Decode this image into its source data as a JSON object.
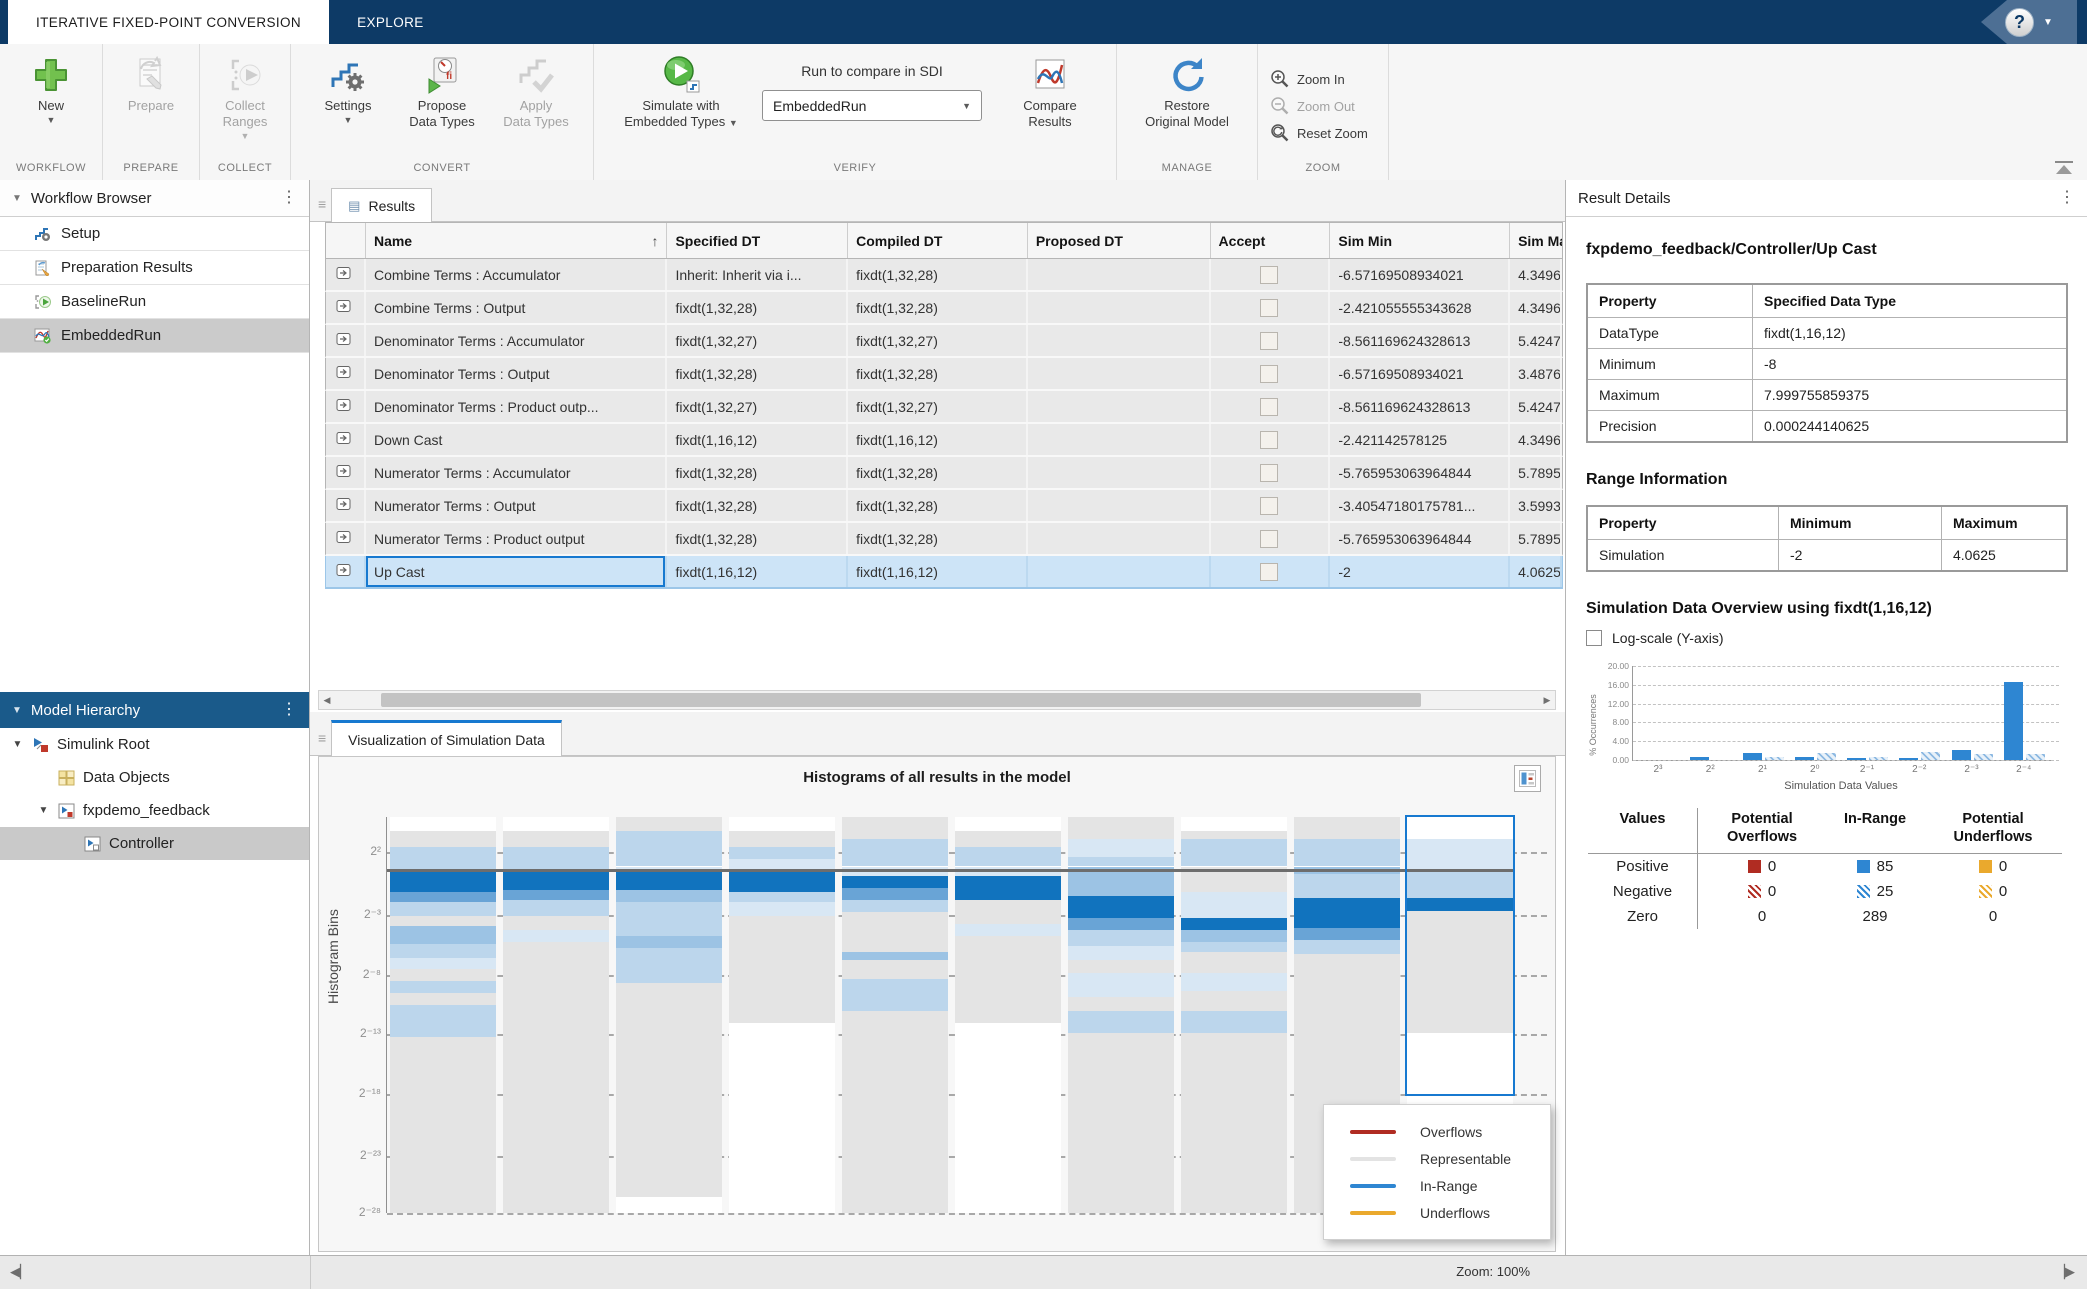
{
  "colors": {
    "tabbar": "#0d3a66",
    "accent_blue": "#1779d0",
    "selection_blue": "#cde4f7",
    "overflow_red": "#b02c22",
    "representable_gray": "#e3e3e3",
    "inrange_blue": "#2e86d2",
    "underflow_yellow": "#eaa92d",
    "hist": {
      "rep": "#e4e4e4",
      "b1": "#d8e7f4",
      "b2": "#bcd6ec",
      "b3": "#9cc3e4",
      "b4": "#69a4d6",
      "b5": "#1173be"
    }
  },
  "icons": {
    "help-icon": "? in circle",
    "new-icon": "green plus",
    "prepare-icon": "document with pencil",
    "collect-icon": "brackets with play",
    "settings-icon": "steps with gear",
    "propose-icon": "gauge fi with play",
    "apply-icon": "steps with check",
    "simulate-icon": "green play circle",
    "compare-icon": "red blue curves",
    "restore-icon": "blue undo arrow",
    "zoom-in-icon": "magnifier plus",
    "zoom-out-icon": "magnifier minus",
    "reset-zoom-icon": "magnifier reset",
    "kebab-icon": "vertical dots",
    "signal-icon": "boxed arrow",
    "sort-ascending-icon": "up arrow",
    "checkbox": "empty square"
  },
  "tabs": {
    "iterative": "ITERATIVE FIXED-POINT CONVERSION",
    "explore": "EXPLORE"
  },
  "ribbon": {
    "sections": [
      "WORKFLOW",
      "PREPARE",
      "COLLECT",
      "CONVERT",
      "VERIFY",
      "MANAGE",
      "ZOOM"
    ],
    "new_label": "New",
    "prepare_label": "Prepare",
    "collect_label": "Collect\nRanges",
    "settings_label": "Settings",
    "propose_label": "Propose\nData Types",
    "apply_label": "Apply\nData Types",
    "simulate_label": "Simulate with\nEmbedded Types",
    "run_compare_label": "Run to compare in SDI",
    "run_dropdown_value": "EmbeddedRun",
    "compare_label": "Compare\nResults",
    "restore_label": "Restore\nOriginal Model",
    "zoom_in_label": "Zoom In",
    "zoom_out_label": "Zoom Out",
    "reset_zoom_label": "Reset Zoom"
  },
  "workflow_browser": {
    "title": "Workflow Browser",
    "items": [
      {
        "label": "Setup",
        "icon": "setup",
        "selected": false
      },
      {
        "label": "Preparation Results",
        "icon": "prep",
        "selected": false
      },
      {
        "label": "BaselineRun",
        "icon": "baseline",
        "selected": false
      },
      {
        "label": "EmbeddedRun",
        "icon": "embedded",
        "selected": true
      }
    ]
  },
  "model_hierarchy": {
    "title": "Model Hierarchy",
    "items": [
      {
        "label": "Simulink Root",
        "depth": 0,
        "expanded": true,
        "icon": "simulink",
        "selected": false
      },
      {
        "label": "Data Objects",
        "depth": 1,
        "expanded": null,
        "icon": "data",
        "selected": false
      },
      {
        "label": "fxpdemo_feedback",
        "depth": 1,
        "expanded": true,
        "icon": "model",
        "selected": false
      },
      {
        "label": "Controller",
        "depth": 2,
        "expanded": null,
        "icon": "subsystem",
        "selected": true
      }
    ]
  },
  "results_panel": {
    "tab": "Results",
    "columns": [
      "",
      "Name",
      "Specified DT",
      "Compiled DT",
      "Proposed DT",
      "Accept",
      "Sim Min",
      "Sim Max"
    ],
    "rows": [
      {
        "name": "Combine Terms : Accumulator",
        "specified": "Inherit: Inherit via i...",
        "compiled": "fixdt(1,32,28)",
        "proposed": "",
        "accept": false,
        "sim_min": "-6.57169508934021",
        "sim_max": "4.3496",
        "selected": false
      },
      {
        "name": "Combine Terms : Output",
        "specified": "fixdt(1,32,28)",
        "compiled": "fixdt(1,32,28)",
        "proposed": "",
        "accept": false,
        "sim_min": "-2.421055555343628",
        "sim_max": "4.3496",
        "selected": false
      },
      {
        "name": "Denominator Terms : Accumulator",
        "specified": "fixdt(1,32,27)",
        "compiled": "fixdt(1,32,27)",
        "proposed": "",
        "accept": false,
        "sim_min": "-8.561169624328613",
        "sim_max": "5.4247",
        "selected": false
      },
      {
        "name": "Denominator Terms : Output",
        "specified": "fixdt(1,32,28)",
        "compiled": "fixdt(1,32,28)",
        "proposed": "",
        "accept": false,
        "sim_min": "-6.57169508934021",
        "sim_max": "3.4876",
        "selected": false
      },
      {
        "name": "Denominator Terms : Product outp...",
        "specified": "fixdt(1,32,27)",
        "compiled": "fixdt(1,32,27)",
        "proposed": "",
        "accept": false,
        "sim_min": "-8.561169624328613",
        "sim_max": "5.4247",
        "selected": false
      },
      {
        "name": "Down Cast",
        "specified": "fixdt(1,16,12)",
        "compiled": "fixdt(1,16,12)",
        "proposed": "",
        "accept": false,
        "sim_min": "-2.421142578125",
        "sim_max": "4.3496",
        "selected": false
      },
      {
        "name": "Numerator Terms : Accumulator",
        "specified": "fixdt(1,32,28)",
        "compiled": "fixdt(1,32,28)",
        "proposed": "",
        "accept": false,
        "sim_min": "-5.765953063964844",
        "sim_max": "5.7895",
        "selected": false
      },
      {
        "name": "Numerator Terms : Output",
        "specified": "fixdt(1,32,28)",
        "compiled": "fixdt(1,32,28)",
        "proposed": "",
        "accept": false,
        "sim_min": "-3.40547180175781...",
        "sim_max": "3.5993",
        "selected": false
      },
      {
        "name": "Numerator Terms : Product output",
        "specified": "fixdt(1,32,28)",
        "compiled": "fixdt(1,32,28)",
        "proposed": "",
        "accept": false,
        "sim_min": "-5.765953063964844",
        "sim_max": "5.7895",
        "selected": false
      },
      {
        "name": "Up Cast",
        "specified": "fixdt(1,16,12)",
        "compiled": "fixdt(1,16,12)",
        "proposed": "",
        "accept": false,
        "sim_min": "-2",
        "sim_max": "4.0625",
        "selected": true
      }
    ]
  },
  "viz_panel": {
    "tab": "Visualization of Simulation Data"
  },
  "chart_data": [
    {
      "type": "heatmap",
      "title": "Histograms of all results in the model",
      "ylabel": "Histogram Bins",
      "yticks": [
        "2²",
        "2⁻³",
        "2⁻⁸",
        "2⁻¹³",
        "2⁻¹⁸",
        "2⁻²³",
        "2⁻²⁸"
      ],
      "ytick_fracs": [
        0.089,
        0.247,
        0.398,
        0.549,
        0.7,
        0.855,
        1.0
      ],
      "refline_frac": 0.132,
      "legend_position": "bottom-right",
      "legend": [
        {
          "label": "Overflows",
          "color": "#b02c22"
        },
        {
          "label": "Representable",
          "color": "#e3e3e3"
        },
        {
          "label": "In-Range",
          "color": "#2e86d2"
        },
        {
          "label": "Underflows",
          "color": "#eaa92d"
        }
      ],
      "columns": [
        {
          "name": "Combine Terms : Accumulator",
          "highlighted": false,
          "segments": [
            [
              0.035,
              0.075,
              "rep"
            ],
            [
              0.075,
              0.132,
              "b2"
            ],
            [
              0.132,
              0.19,
              "b5"
            ],
            [
              0.19,
              0.215,
              "b4"
            ],
            [
              0.215,
              0.25,
              "b2"
            ],
            [
              0.25,
              0.275,
              "rep"
            ],
            [
              0.275,
              0.32,
              "b3"
            ],
            [
              0.32,
              0.355,
              "b2"
            ],
            [
              0.355,
              0.385,
              "b1"
            ],
            [
              0.385,
              0.415,
              "rep"
            ],
            [
              0.415,
              0.445,
              "b2"
            ],
            [
              0.445,
              0.475,
              "rep"
            ],
            [
              0.475,
              0.555,
              "b2"
            ],
            [
              0.555,
              1,
              "rep"
            ]
          ]
        },
        {
          "name": "Combine Terms : Output",
          "highlighted": false,
          "segments": [
            [
              0.035,
              0.075,
              "rep"
            ],
            [
              0.075,
              0.132,
              "b2"
            ],
            [
              0.132,
              0.185,
              "b5"
            ],
            [
              0.185,
              0.21,
              "b4"
            ],
            [
              0.21,
              0.25,
              "b2"
            ],
            [
              0.25,
              0.285,
              "rep"
            ],
            [
              0.285,
              0.315,
              "b1"
            ],
            [
              0.315,
              1,
              "rep"
            ]
          ]
        },
        {
          "name": "Denominator Terms : Accumulator",
          "highlighted": false,
          "segments": [
            [
              0,
              0.035,
              "rep"
            ],
            [
              0.035,
              0.125,
              "b2"
            ],
            [
              0.125,
              0.132,
              "b1"
            ],
            [
              0.132,
              0.185,
              "b5"
            ],
            [
              0.185,
              0.215,
              "b3"
            ],
            [
              0.215,
              0.3,
              "b2"
            ],
            [
              0.3,
              0.33,
              "b3"
            ],
            [
              0.33,
              0.42,
              "b2"
            ],
            [
              0.42,
              0.96,
              "rep"
            ]
          ]
        },
        {
          "name": "Denominator Terms : Output",
          "highlighted": false,
          "segments": [
            [
              0.035,
              0.075,
              "rep"
            ],
            [
              0.075,
              0.105,
              "b2"
            ],
            [
              0.105,
              0.132,
              "b1"
            ],
            [
              0.132,
              0.19,
              "b5"
            ],
            [
              0.19,
              0.215,
              "b2"
            ],
            [
              0.215,
              0.25,
              "b1"
            ],
            [
              0.25,
              0.52,
              "rep"
            ]
          ]
        },
        {
          "name": "Denominator Terms : Product output",
          "highlighted": false,
          "segments": [
            [
              0,
              0.056,
              "rep"
            ],
            [
              0.056,
              0.125,
              "b2"
            ],
            [
              0.125,
              0.148,
              "b1"
            ],
            [
              0.148,
              0.18,
              "b5"
            ],
            [
              0.18,
              0.21,
              "b4"
            ],
            [
              0.21,
              0.24,
              "b2"
            ],
            [
              0.24,
              0.34,
              "rep"
            ],
            [
              0.34,
              0.36,
              "b3"
            ],
            [
              0.36,
              0.41,
              "rep"
            ],
            [
              0.41,
              0.49,
              "b2"
            ],
            [
              0.49,
              1,
              "rep"
            ]
          ]
        },
        {
          "name": "Down Cast",
          "highlighted": false,
          "segments": [
            [
              0.035,
              0.075,
              "rep"
            ],
            [
              0.075,
              0.125,
              "b2"
            ],
            [
              0.125,
              0.148,
              "b1"
            ],
            [
              0.148,
              0.21,
              "b5"
            ],
            [
              0.21,
              0.27,
              "rep"
            ],
            [
              0.27,
              0.3,
              "b1"
            ],
            [
              0.3,
              0.52,
              "rep"
            ]
          ]
        },
        {
          "name": "Numerator Terms : Accumulator",
          "highlighted": false,
          "segments": [
            [
              0,
              0.056,
              "rep"
            ],
            [
              0.056,
              0.1,
              "b1"
            ],
            [
              0.1,
              0.125,
              "b2"
            ],
            [
              0.125,
              0.2,
              "b3"
            ],
            [
              0.2,
              0.255,
              "b5"
            ],
            [
              0.255,
              0.285,
              "b4"
            ],
            [
              0.285,
              0.325,
              "b2"
            ],
            [
              0.325,
              0.36,
              "b1"
            ],
            [
              0.36,
              0.395,
              "rep"
            ],
            [
              0.395,
              0.455,
              "b1"
            ],
            [
              0.455,
              0.49,
              "rep"
            ],
            [
              0.49,
              0.545,
              "b2"
            ],
            [
              0.545,
              1,
              "rep"
            ]
          ]
        },
        {
          "name": "Numerator Terms : Output",
          "highlighted": false,
          "segments": [
            [
              0.035,
              0.056,
              "rep"
            ],
            [
              0.056,
              0.125,
              "b2"
            ],
            [
              0.125,
              0.19,
              "rep"
            ],
            [
              0.19,
              0.255,
              "b1"
            ],
            [
              0.255,
              0.285,
              "b5"
            ],
            [
              0.285,
              0.315,
              "b3"
            ],
            [
              0.315,
              0.34,
              "b2"
            ],
            [
              0.34,
              0.395,
              "rep"
            ],
            [
              0.395,
              0.44,
              "b1"
            ],
            [
              0.44,
              0.49,
              "rep"
            ],
            [
              0.49,
              0.545,
              "b2"
            ],
            [
              0.545,
              1,
              "rep"
            ]
          ]
        },
        {
          "name": "Numerator Terms : Product output",
          "highlighted": false,
          "segments": [
            [
              0,
              0.056,
              "rep"
            ],
            [
              0.056,
              0.125,
              "b2"
            ],
            [
              0.125,
              0.145,
              "b3"
            ],
            [
              0.145,
              0.205,
              "b2"
            ],
            [
              0.205,
              0.28,
              "b5"
            ],
            [
              0.28,
              0.31,
              "b4"
            ],
            [
              0.31,
              0.345,
              "b2"
            ],
            [
              0.345,
              1,
              "rep"
            ]
          ]
        },
        {
          "name": "Up Cast",
          "highlighted": true,
          "highlight_bottom_frac": 0.7,
          "segments": [
            [
              0.056,
              0.135,
              "b1"
            ],
            [
              0.135,
              0.205,
              "b2"
            ],
            [
              0.205,
              0.237,
              "b5"
            ],
            [
              0.237,
              0.545,
              "rep"
            ]
          ]
        }
      ]
    },
    {
      "type": "bar",
      "title": "Simulation Data Overview using fixdt(1,16,12)",
      "xlabel": "Simulation Data Values",
      "ylabel": "% Occurrences",
      "ylim": [
        0,
        20
      ],
      "yticks": [
        "0.00",
        "4.00",
        "8.00",
        "12.00",
        "16.00",
        "20.00"
      ],
      "categories": [
        "2³",
        "2²",
        "2¹",
        "2⁰",
        "2⁻¹",
        "2⁻²",
        "2⁻³",
        "2⁻⁴"
      ],
      "series": [
        {
          "name": "Positive (solid)",
          "values": [
            0,
            0.6,
            1.4,
            0.6,
            0.4,
            0.4,
            2.1,
            16.6
          ]
        },
        {
          "name": "Negative (hatched)",
          "values": [
            0,
            0,
            0.6,
            1.4,
            0.7,
            1.8,
            1.3,
            1.2
          ]
        }
      ]
    }
  ],
  "result_details": {
    "title": "Result Details",
    "path": "fxpdemo_feedback/Controller/Up Cast",
    "spec_table": {
      "headers": [
        "Property",
        "Specified Data Type"
      ],
      "rows": [
        [
          "DataType",
          "fixdt(1,16,12)"
        ],
        [
          "Minimum",
          "-8"
        ],
        [
          "Maximum",
          "7.999755859375"
        ],
        [
          "Precision",
          "0.000244140625"
        ]
      ]
    },
    "range_heading": "Range Information",
    "range_table": {
      "headers": [
        "Property",
        "Minimum",
        "Maximum"
      ],
      "rows": [
        [
          "Simulation",
          "-2",
          "4.0625"
        ]
      ]
    },
    "overview_heading": "Simulation Data Overview using fixdt(1,16,12)",
    "log_checkbox_label": "Log-scale (Y-axis)",
    "values_table": {
      "headers": [
        "Values",
        "Potential\nOverflows",
        "In-Range",
        "Potential\nUnderflows"
      ],
      "rows": [
        {
          "label": "Positive",
          "swatch": "solid",
          "overflows": "0",
          "inrange": "85",
          "underflows": "0"
        },
        {
          "label": "Negative",
          "swatch": "hatched",
          "overflows": "0",
          "inrange": "25",
          "underflows": "0"
        },
        {
          "label": "Zero",
          "swatch": "none",
          "overflows": "0",
          "inrange": "289",
          "underflows": "0"
        }
      ]
    }
  },
  "statusbar": {
    "zoom": "Zoom: 100%"
  }
}
